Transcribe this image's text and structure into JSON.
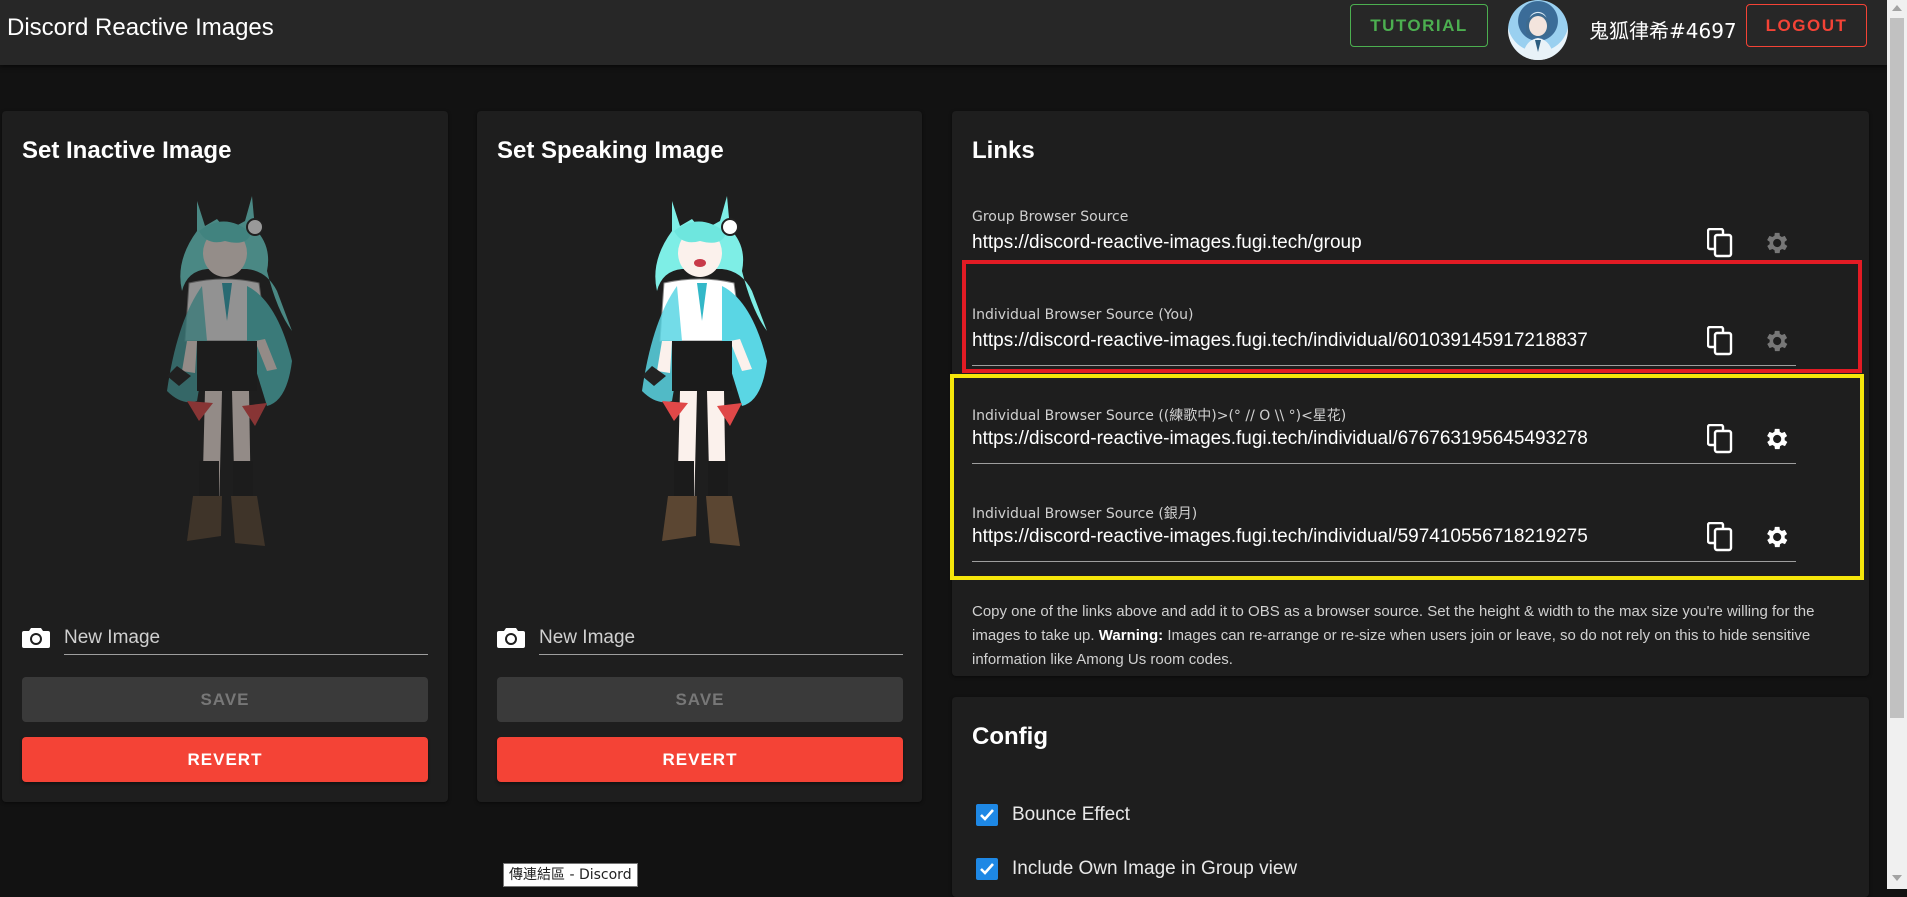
{
  "header": {
    "title": "Discord Reactive Images",
    "tutorial_label": "TUTORIAL",
    "username": "鬼狐律希#4697",
    "logout_label": "LOGOUT"
  },
  "inactive_card": {
    "title": "Set Inactive Image",
    "input_placeholder": "New Image",
    "save_label": "SAVE",
    "revert_label": "REVERT"
  },
  "speaking_card": {
    "title": "Set Speaking Image",
    "input_placeholder": "New Image",
    "save_label": "SAVE",
    "revert_label": "REVERT"
  },
  "links": {
    "title": "Links",
    "items": [
      {
        "label": "Group Browser Source",
        "url": "https://discord-reactive-images.fugi.tech/group"
      },
      {
        "label": "Individual Browser Source (You)",
        "url": "https://discord-reactive-images.fugi.tech/individual/601039145917218837"
      },
      {
        "label": "Individual Browser Source ((練歌中)>(° // O \\\\ °)<星花)",
        "url": "https://discord-reactive-images.fugi.tech/individual/676763195645493278"
      },
      {
        "label": "Individual Browser Source (銀月)",
        "url": "https://discord-reactive-images.fugi.tech/individual/597410556718219275"
      }
    ],
    "help_pre": "Copy one of the links above and add it to OBS as a browser source. Set the height & width to the max size you're willing for the images to take up.",
    "help_warning": "Warning:",
    "help_post": "Images can re-arrange or re-size when users join or leave, so do not rely on this to hide sensitive information like Among Us room codes."
  },
  "config": {
    "title": "Config",
    "options": [
      {
        "label": "Bounce Effect",
        "checked": true
      },
      {
        "label": "Include Own Image in Group view",
        "checked": true
      }
    ]
  },
  "tooltip": "傳連結區 - Discord",
  "colors": {
    "tutorial": "#4caf50",
    "logout": "#f44336",
    "revert": "#f44336",
    "checkbox": "#1e88e5",
    "highlight_red": "#e21b24",
    "highlight_yellow": "#f5e60a"
  }
}
